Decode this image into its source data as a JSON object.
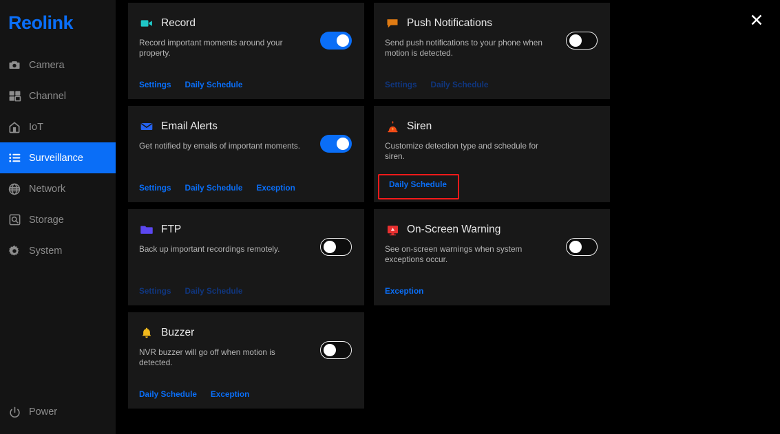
{
  "brand": "Reolink",
  "sidebar": {
    "items": [
      {
        "label": "Camera",
        "icon": "camera-icon",
        "active": false
      },
      {
        "label": "Channel",
        "icon": "grid-icon",
        "active": false
      },
      {
        "label": "IoT",
        "icon": "home-icon",
        "active": false
      },
      {
        "label": "Surveillance",
        "icon": "list-icon",
        "active": true
      },
      {
        "label": "Network",
        "icon": "globe-icon",
        "active": false
      },
      {
        "label": "Storage",
        "icon": "hard-drive-icon",
        "active": false
      },
      {
        "label": "System",
        "icon": "gear-icon",
        "active": false
      }
    ],
    "power": {
      "label": "Power",
      "icon": "power-icon"
    },
    "active_color": "#0a6ef7",
    "brand_color": "#0a6ef7"
  },
  "header": {
    "close_label": "✕",
    "close_icon": "close-icon"
  },
  "cards": [
    {
      "id": "record",
      "title": "Record",
      "icon": "video-camera-icon",
      "icon_color": "#1fc7c7",
      "description": "Record important moments around your property.",
      "toggle": {
        "state": "on",
        "label": "Record toggle"
      },
      "links": [
        {
          "label": "Settings",
          "enabled": true
        },
        {
          "label": "Daily Schedule",
          "enabled": true
        }
      ]
    },
    {
      "id": "push-notifications",
      "title": "Push Notifications",
      "icon": "speech-bubble-icon",
      "icon_color": "#e07b13",
      "description": "Send push notifications to your phone when motion is detected.",
      "toggle": {
        "state": "off",
        "label": "Push Notifications toggle"
      },
      "links": [
        {
          "label": "Settings",
          "enabled": false
        },
        {
          "label": "Daily Schedule",
          "enabled": false
        }
      ]
    },
    {
      "id": "email-alerts",
      "title": "Email Alerts",
      "icon": "envelope-icon",
      "icon_color": "#2563f0",
      "description": "Get notified by emails of important moments.",
      "toggle": {
        "state": "on",
        "label": "Email Alerts toggle"
      },
      "links": [
        {
          "label": "Settings",
          "enabled": true
        },
        {
          "label": "Daily Schedule",
          "enabled": true
        },
        {
          "label": "Exception",
          "enabled": true
        }
      ]
    },
    {
      "id": "siren",
      "title": "Siren",
      "icon": "siren-icon",
      "icon_color": "#f04a16",
      "description": "Customize detection type and schedule for siren.",
      "toggle": null,
      "links": [
        {
          "label": "Daily Schedule",
          "enabled": true,
          "highlighted": true
        }
      ]
    },
    {
      "id": "ftp",
      "title": "FTP",
      "icon": "folder-icon",
      "icon_color": "#5b47f0",
      "description": "Back up important recordings remotely.",
      "toggle": {
        "state": "off",
        "label": "FTP toggle"
      },
      "links": [
        {
          "label": "Settings",
          "enabled": false
        },
        {
          "label": "Daily Schedule",
          "enabled": false
        }
      ]
    },
    {
      "id": "on-screen-warning",
      "title": "On-Screen Warning",
      "icon": "monitor-warning-icon",
      "icon_color": "#e83030",
      "description": "See on-screen warnings when system exceptions occur.",
      "toggle": {
        "state": "off",
        "label": "On-Screen Warning toggle"
      },
      "links": [
        {
          "label": "Exception",
          "enabled": true
        }
      ]
    },
    {
      "id": "buzzer",
      "title": "Buzzer",
      "icon": "bell-icon",
      "icon_color": "#f2b91c",
      "description": "NVR buzzer will go off when motion is detected.",
      "toggle": {
        "state": "off",
        "label": "Buzzer toggle"
      },
      "links": [
        {
          "label": "Daily Schedule",
          "enabled": true
        },
        {
          "label": "Exception",
          "enabled": true
        }
      ]
    }
  ],
  "highlight": {
    "color": "#ff1a1a",
    "target": "siren-daily-schedule-link"
  },
  "cursor": {
    "icon": "mouse-pointer-icon"
  }
}
